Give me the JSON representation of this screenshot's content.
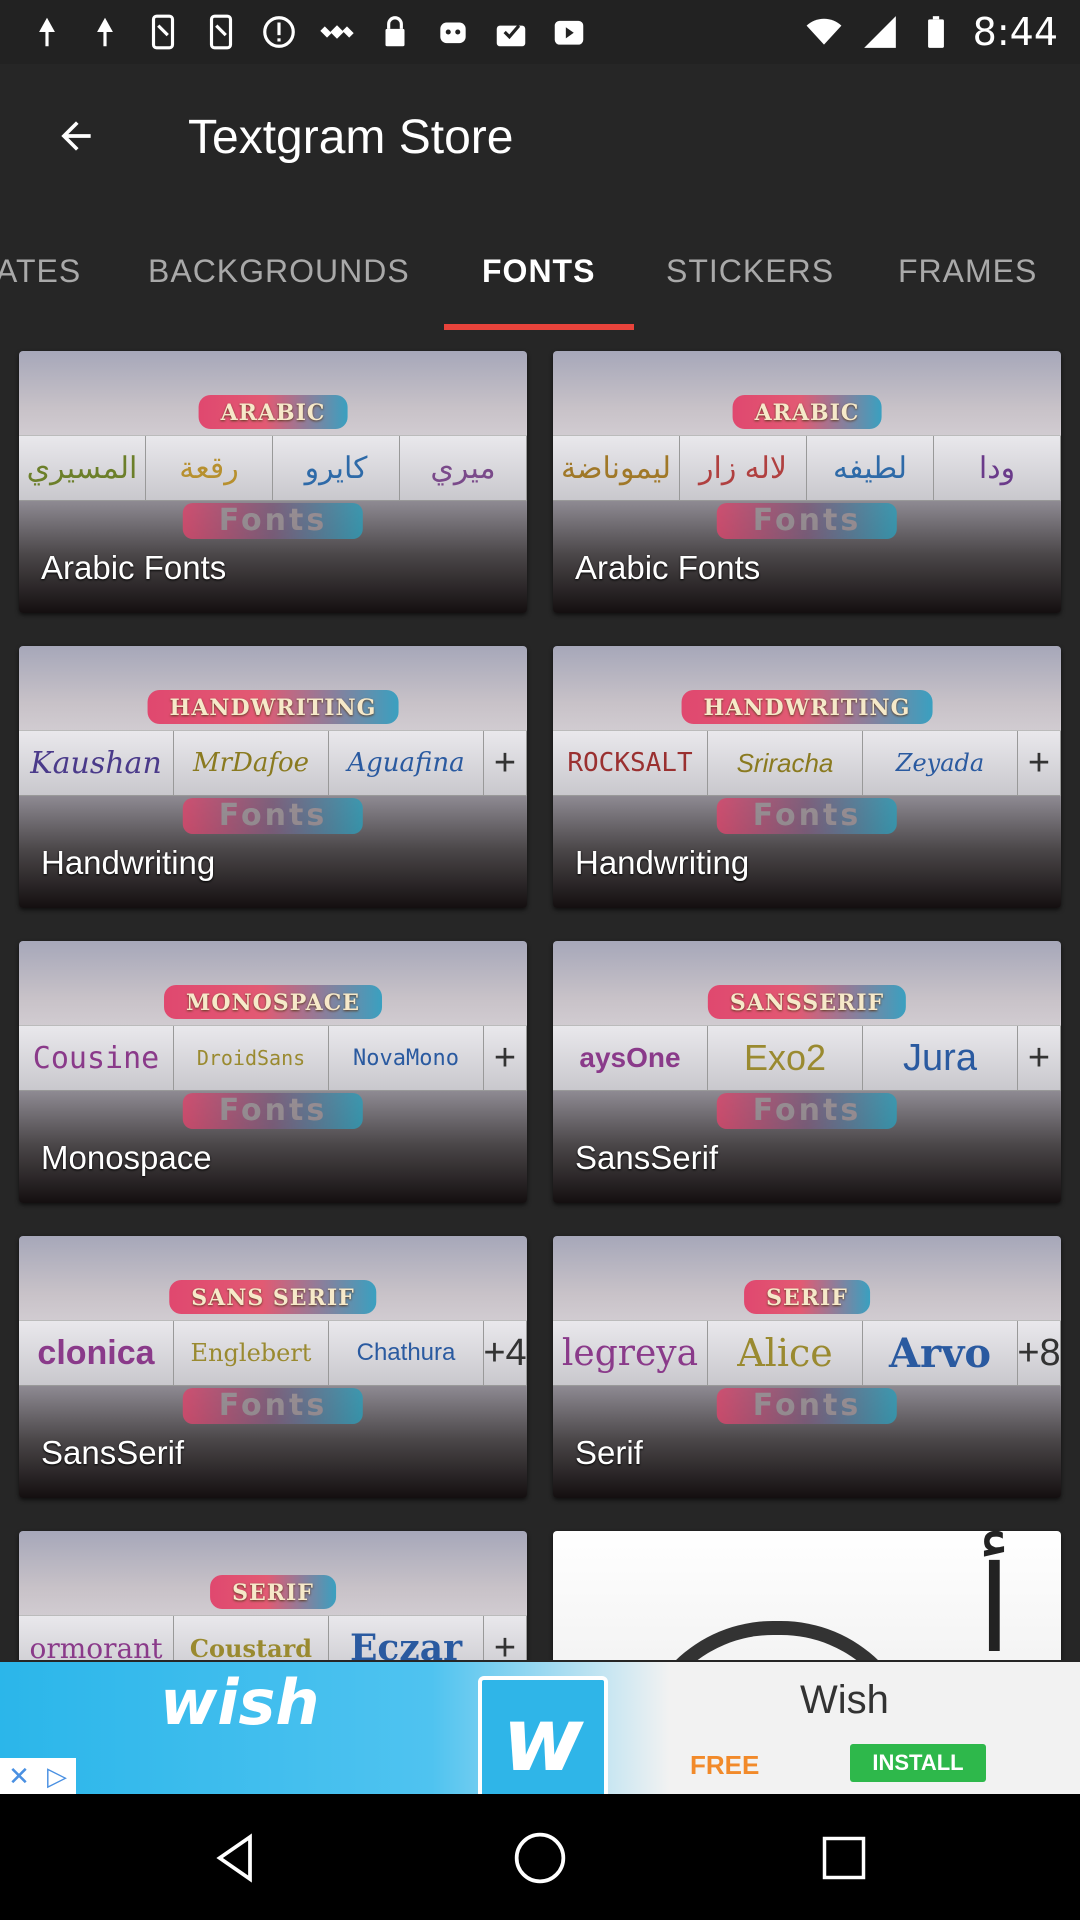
{
  "status_bar": {
    "time": "8:44",
    "icons": [
      "notification-icon",
      "notification-icon",
      "phone-icon",
      "phone-icon",
      "info-icon",
      "satellite-icon",
      "lock-icon",
      "robot-icon",
      "tray-icon",
      "play-icon"
    ]
  },
  "app_bar": {
    "title": "Textgram Store"
  },
  "tabs": [
    {
      "label": "ATES"
    },
    {
      "label": "BACKGROUNDS"
    },
    {
      "label": "FONTS"
    },
    {
      "label": "STICKERS"
    },
    {
      "label": "FRAMES"
    }
  ],
  "active_tab": "FONTS",
  "cards": [
    {
      "badge": "ARABIC",
      "samples": [
        "المسيري",
        "رقعة",
        "كايرو",
        "ميري"
      ],
      "fonts_word": "Fonts",
      "label": "Arabic Fonts"
    },
    {
      "badge": "ARABIC",
      "samples": [
        "ليموناضة",
        "لاله زار",
        "لطيفه",
        "ودا"
      ],
      "fonts_word": "Fonts",
      "label": "Arabic Fonts"
    },
    {
      "badge": "HANDWRITING",
      "samples": [
        "Kaushan",
        "MrDafoe",
        "Aguafina",
        "+"
      ],
      "fonts_word": "Fonts",
      "label": "Handwriting"
    },
    {
      "badge": "HANDWRITING",
      "samples": [
        "ROCKSALT",
        "Sriracha",
        "Zeyada",
        "+"
      ],
      "fonts_word": "Fonts",
      "label": "Handwriting"
    },
    {
      "badge": "MONOSPACE",
      "samples": [
        "Cousine",
        "DroidSans",
        "NovaMono",
        "+"
      ],
      "fonts_word": "Fonts",
      "label": "Monospace"
    },
    {
      "badge": "SANSSERIF",
      "samples": [
        "aysOne",
        "Exo2",
        "Jura",
        "+"
      ],
      "fonts_word": "Fonts",
      "label": "SansSerif"
    },
    {
      "badge": "SANS SERIF",
      "samples": [
        "clonica",
        "Englebert",
        "Chathura",
        "+4"
      ],
      "fonts_word": "Fonts",
      "label": "SansSerif"
    },
    {
      "badge": "SERIF",
      "samples": [
        "legreya",
        "Alice",
        "Arvo",
        "+8"
      ],
      "fonts_word": "Fonts",
      "label": "Serif"
    },
    {
      "badge": "SERIF",
      "samples": [
        "ormorant",
        "Coustard",
        "Eczar",
        "+"
      ],
      "fonts_word": "",
      "label": ""
    },
    {
      "badge": "",
      "samples": [],
      "fonts_word": "",
      "label": "",
      "glyph": "أ"
    }
  ],
  "ad": {
    "brand": "wish",
    "logo_letter": "w",
    "title": "Wish",
    "free": "FREE",
    "install": "INSTALL",
    "close": "✕",
    "adchoices": "▷"
  },
  "colors": {
    "background": "#262626",
    "tab_indicator": "#e8433b",
    "ad_blue": "#2bb6ea",
    "install_green": "#2eb84b"
  }
}
